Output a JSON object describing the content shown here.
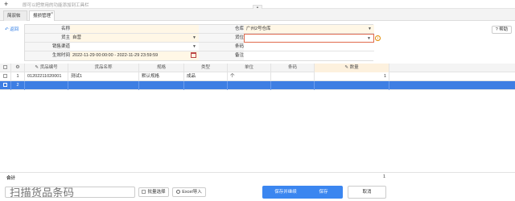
{
  "topbar": {
    "hint": "即可以把常用的功能添加到工具栏",
    "collapse_icon": "chevron-up-icon"
  },
  "tabs": [
    {
      "label": "简驭帖"
    },
    {
      "label": "报损管理"
    }
  ],
  "actions": {
    "back": "返回",
    "help": "帮助"
  },
  "form": {
    "name_label": "名称",
    "name_value": "",
    "warehouse_label": "仓库",
    "warehouse_value": "广州2号仓库",
    "owner_label": "货主",
    "owner_value": "自营",
    "location_label": "货位",
    "location_value": "",
    "channel_label": "销售渠道",
    "channel_value": "",
    "barcode_label": "条码",
    "barcode_value": "",
    "time_label": "生效时间",
    "time_value": "2022-11-29 00:00:00 - 2022-11-29 23:59:59",
    "remark_label": "备注",
    "remark_value": ""
  },
  "grid": {
    "columns": [
      "货品编号",
      "货品名称",
      "规格",
      "类型",
      "单位",
      "条码",
      "数量"
    ],
    "rows": [
      {
        "no": "1",
        "cells": [
          "01202211020001",
          "测试1",
          "默认规格",
          "成品",
          "个",
          "",
          "1"
        ]
      },
      {
        "no": "2",
        "cells": [
          "",
          "",
          "",
          "",
          "",
          "",
          ""
        ]
      }
    ]
  },
  "summary": {
    "label": "合计",
    "value": "1"
  },
  "bottom": {
    "scan_placeholder": "扫描货品条码",
    "batch_select": "批量选择",
    "excel_import": "Excel导入",
    "save_continue": "保存并继续",
    "save": "保存",
    "cancel": "取消"
  },
  "colors": {
    "primary": "#3b86f0",
    "selected_row": "#3e7ee3",
    "required": "#fff7e6"
  }
}
